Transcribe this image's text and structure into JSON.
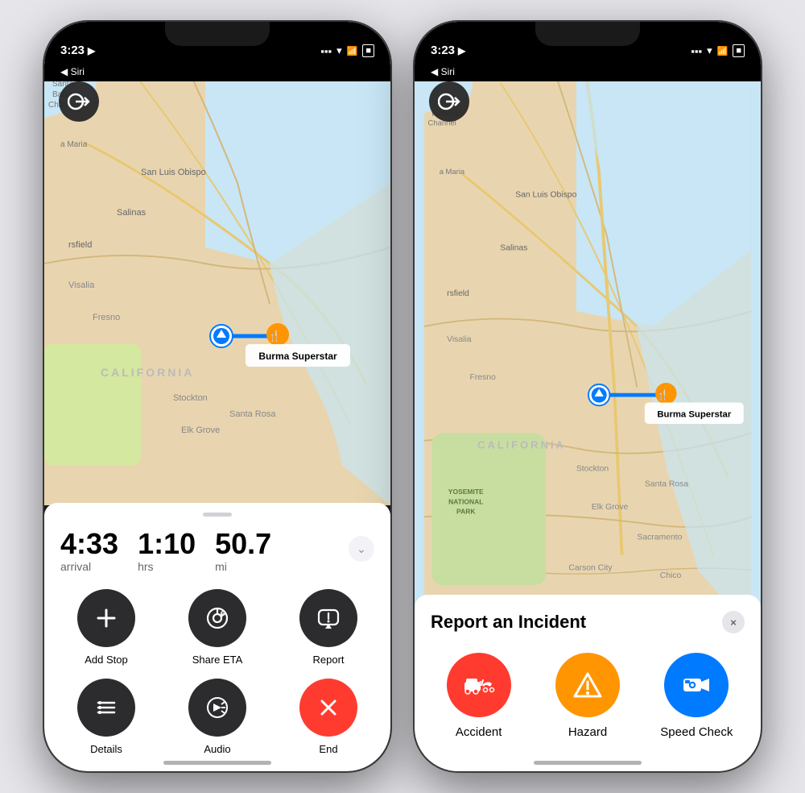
{
  "phone1": {
    "status": {
      "time": "3:23",
      "time_icon": "▶",
      "siri": "◀ Siri"
    },
    "back_button": "⊙→",
    "map": {
      "destination": "Burma Superstar",
      "region": "CALIFORNIA"
    },
    "nav_panel": {
      "arrival": "4:33",
      "arrival_label": "arrival",
      "duration": "1:10",
      "duration_label": "hrs",
      "distance": "50.7",
      "distance_label": "mi"
    },
    "actions": [
      {
        "id": "add-stop",
        "label": "Add Stop",
        "icon": "+",
        "color": "dark"
      },
      {
        "id": "share-eta",
        "label": "Share ETA",
        "icon": "share",
        "color": "dark"
      },
      {
        "id": "report",
        "label": "Report",
        "icon": "chat",
        "color": "dark"
      },
      {
        "id": "details",
        "label": "Details",
        "icon": "list",
        "color": "dark"
      },
      {
        "id": "audio",
        "label": "Audio",
        "icon": "speaker",
        "color": "dark"
      },
      {
        "id": "end",
        "label": "End",
        "icon": "×",
        "color": "red"
      }
    ]
  },
  "phone2": {
    "status": {
      "time": "3:23",
      "siri": "◀ Siri"
    },
    "back_button": "⊙→",
    "map": {
      "destination": "Burma Superstar",
      "region": "CALIFORNIA"
    },
    "report": {
      "title": "Report an Incident",
      "close": "×",
      "incidents": [
        {
          "id": "accident",
          "label": "Accident",
          "color": "red",
          "icon": "🚗"
        },
        {
          "id": "hazard",
          "label": "Hazard",
          "color": "yellow",
          "icon": "⚠"
        },
        {
          "id": "speed-check",
          "label": "Speed Check",
          "color": "blue",
          "icon": "📷"
        }
      ]
    }
  }
}
